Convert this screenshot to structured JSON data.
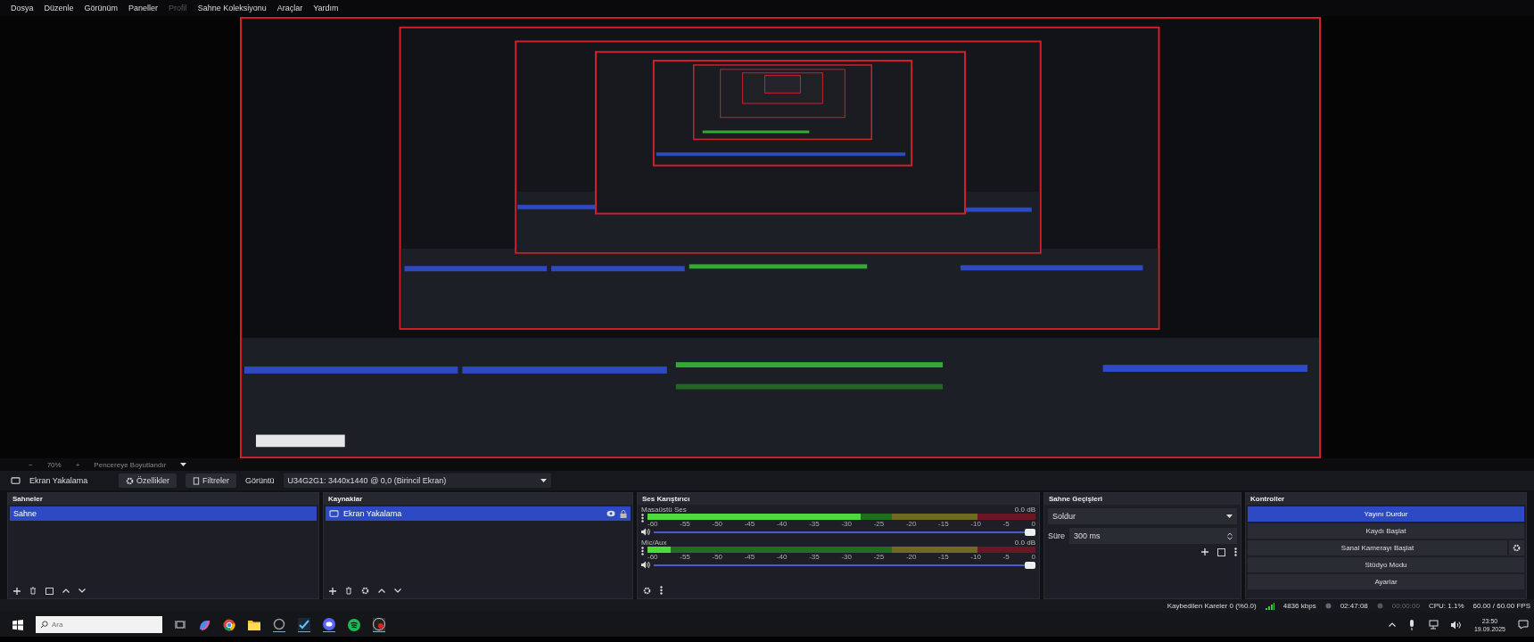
{
  "menu": [
    {
      "label": "Dosya",
      "disabled": false
    },
    {
      "label": "Düzenle",
      "disabled": false
    },
    {
      "label": "Görünüm",
      "disabled": false
    },
    {
      "label": "Paneller",
      "disabled": false
    },
    {
      "label": "Profil",
      "disabled": true
    },
    {
      "label": "Sahne Koleksiyonu",
      "disabled": false
    },
    {
      "label": "Araçlar",
      "disabled": false
    },
    {
      "label": "Yardım",
      "disabled": false
    }
  ],
  "zoom_bar": {
    "minus": "−",
    "zoom": "70%",
    "plus": "+",
    "mode": "Pencereye Boyutlandır"
  },
  "source_toolbar": {
    "source": "Ekran Yakalama",
    "properties": "Özellikler",
    "filters": "Filtreler",
    "display_label": "Görüntü",
    "display_value": "U34G2G1: 3440x1440 @ 0,0 (Birincil Ekran)"
  },
  "scenes": {
    "title": "Sahneler",
    "items": [
      {
        "label": "Sahne",
        "selected": true
      }
    ]
  },
  "sources": {
    "title": "Kaynaklar",
    "items": [
      {
        "label": "Ekran Yakalama",
        "selected": true,
        "visible": true,
        "locked": true
      }
    ]
  },
  "mixer": {
    "title": "Ses Karıştırıcı",
    "channels": [
      {
        "name": "Masaüstü Ses",
        "reading": "0.0 dB",
        "meter": {
          "level": 0.55
        },
        "fader": {
          "level": 1
        },
        "ticks": [
          "-60",
          "-55",
          "-50",
          "-45",
          "-40",
          "-35",
          "-30",
          "-25",
          "-20",
          "-15",
          "-10",
          "-5",
          "0"
        ]
      },
      {
        "name": "Mic/Aux",
        "reading": "0.0 dB",
        "meter": {
          "level": 0.06
        },
        "fader": {
          "level": 1
        },
        "ticks": [
          "-60",
          "-55",
          "-50",
          "-45",
          "-40",
          "-35",
          "-30",
          "-25",
          "-20",
          "-15",
          "-10",
          "-5",
          "0"
        ]
      }
    ]
  },
  "transitions": {
    "title": "Sahne Geçişleri",
    "transition": "Soldur",
    "duration_label": "Süre",
    "duration": "300 ms"
  },
  "controls": {
    "title": "Kontroller",
    "buttons": [
      {
        "label": "Yayını Durdur",
        "active": true,
        "kind": "plain"
      },
      {
        "label": "Kaydı Başlat",
        "active": false,
        "kind": "plain"
      },
      {
        "label": "Sanal Kamerayı Başlat",
        "active": false,
        "kind": "gear"
      },
      {
        "label": "Stüdyo Modu",
        "active": false,
        "kind": "plain"
      },
      {
        "label": "Ayarlar",
        "active": false,
        "kind": "plain"
      }
    ]
  },
  "status_bar": {
    "dropped": "Kaybedilen Kareler 0 (%0.0)",
    "bitrate": "4836 kbps",
    "stream_time": "02:47:08",
    "record_time": "00:00:00",
    "cpu": "CPU: 1.1%",
    "fps": "60.00 / 60.00 FPS"
  },
  "taskbar": {
    "search_placeholder": "Ara",
    "time": "23:50",
    "date": "19.09.2025"
  }
}
